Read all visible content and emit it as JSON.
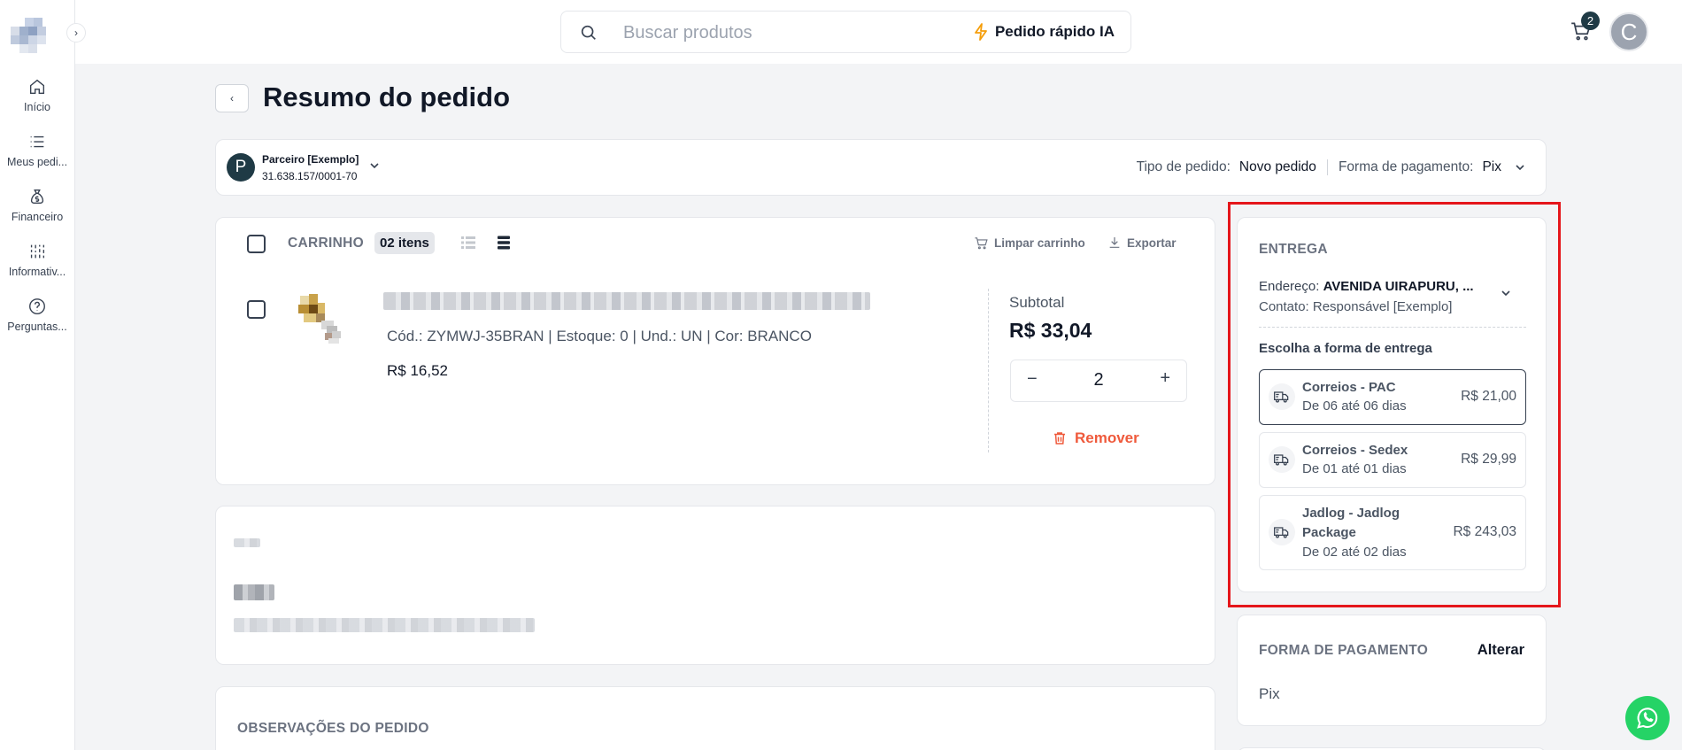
{
  "sidebar": {
    "items": [
      {
        "label": "Início",
        "icon": "home-icon"
      },
      {
        "label": "Meus pedi...",
        "icon": "list-icon"
      },
      {
        "label": "Financeiro",
        "icon": "money-bag-icon"
      },
      {
        "label": "Informativ...",
        "icon": "info-bars-icon"
      },
      {
        "label": "Perguntas...",
        "icon": "question-icon"
      }
    ]
  },
  "header": {
    "search_placeholder": "Buscar produtos",
    "quick_order_label": "Pedido rápido IA",
    "cart_count": "2",
    "avatar_initial": "C"
  },
  "page": {
    "title": "Resumo do pedido"
  },
  "partner": {
    "initial": "P",
    "name": "Parceiro [Exemplo]",
    "document": "31.638.157/0001-70",
    "order_type_label": "Tipo de pedido:",
    "order_type_value": "Novo pedido",
    "payment_label": "Forma de pagamento:",
    "payment_value": "Pix"
  },
  "cart": {
    "label": "CARRINHO",
    "items_badge": "02 itens",
    "clear_label": "Limpar carrinho",
    "export_label": "Exportar",
    "product": {
      "meta": "Cód.: ZYMWJ-35BRAN | Estoque: 0 | Und.: UN | Cor: BRANCO",
      "unit_price": "R$ 16,52",
      "subtotal_label": "Subtotal",
      "subtotal_value": "R$ 33,04",
      "quantity": "2",
      "remove_label": "Remover"
    }
  },
  "observations": {
    "title": "OBSERVAÇÕES DO PEDIDO"
  },
  "delivery": {
    "title": "ENTREGA",
    "address_label": "Endereço:",
    "address_value": "AVENIDA UIRAPURU, ...",
    "contact": "Contato: Responsável [Exemplo]",
    "choose_label": "Escolha a forma de entrega",
    "options": [
      {
        "name": "Correios - PAC",
        "days": "De 06 até 06 dias",
        "price": "R$ 21,00",
        "selected": true
      },
      {
        "name": "Correios - Sedex",
        "days": "De 01 até 01 dias",
        "price": "R$ 29,99",
        "selected": false
      },
      {
        "name": "Jadlog - Jadlog Package",
        "days": "De 02 até 02 dias",
        "price": "R$ 243,03",
        "selected": false
      }
    ]
  },
  "payment": {
    "title": "FORMA DE PAGAMENTO",
    "change_label": "Alterar",
    "value": "Pix"
  },
  "colors": {
    "accent_dark": "#1f3a45",
    "remove_red": "#ef5a3c",
    "highlight_red": "#e5161b",
    "whatsapp_green": "#25d366"
  }
}
